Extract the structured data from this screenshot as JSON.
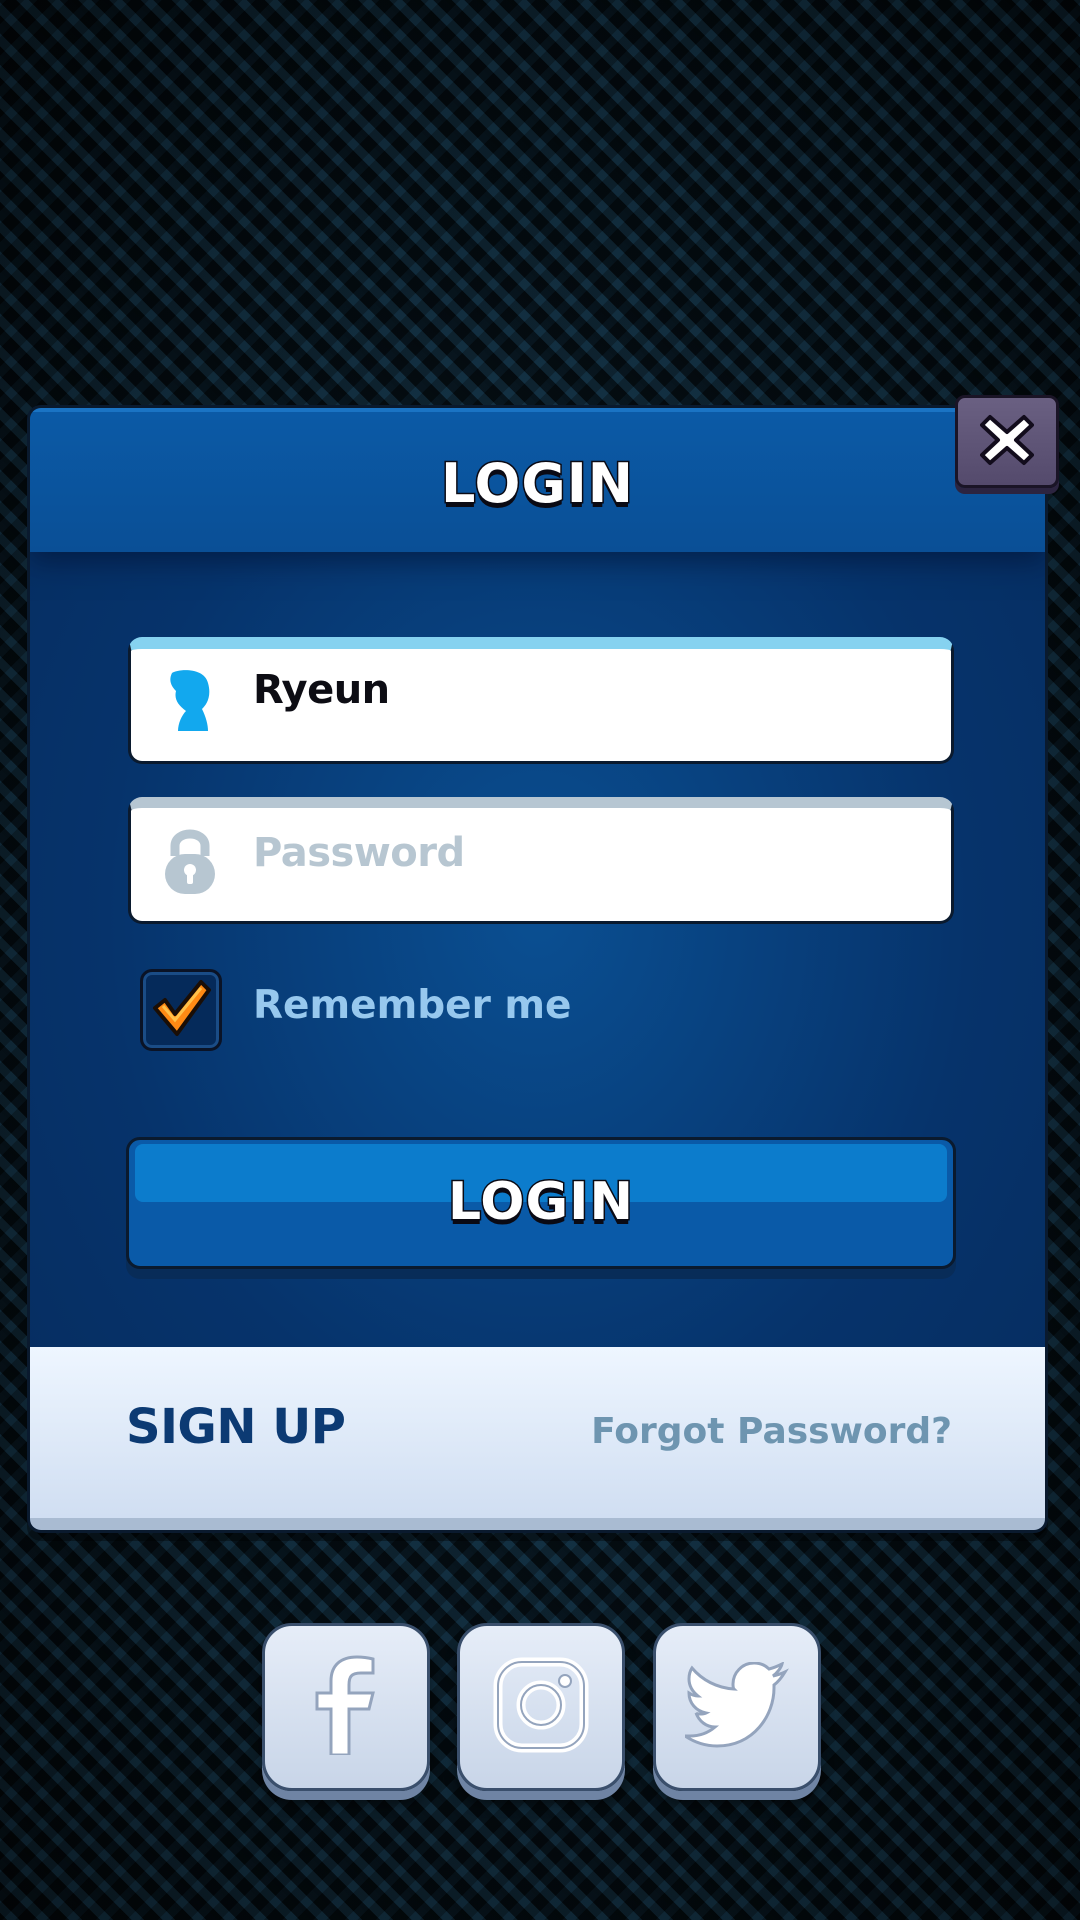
{
  "dialog": {
    "title": "LOGIN",
    "username_value": "Ryeun",
    "password_placeholder": "Password",
    "remember_label": "Remember me",
    "remember_checked": true,
    "login_button": "LOGIN",
    "signup_link": "SIGN UP",
    "forgot_link": "Forgot Password?"
  },
  "icons": {
    "close": "close-icon",
    "user": "user-icon",
    "lock": "lock-icon",
    "check": "checkmark-icon",
    "social": [
      "facebook-icon",
      "instagram-icon",
      "twitter-icon"
    ]
  },
  "colors": {
    "panel": "#06336b",
    "header": "#0a4f96",
    "button": "#0c7ccc",
    "check": "#ff8a14",
    "footer": "#e4eefa"
  }
}
